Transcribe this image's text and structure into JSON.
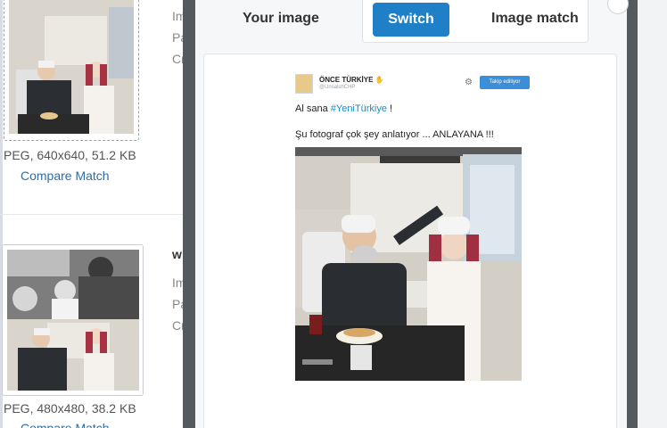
{
  "results": [
    {
      "format_size": "PEG, 640x640, 51.2 KB",
      "compare": "Compare Match",
      "labels": [
        "Im",
        "Pa",
        "Cr"
      ]
    },
    {
      "title": "w",
      "format_size": "PEG, 480x480, 38.2 KB",
      "compare": "Compare Match",
      "labels": [
        "Im",
        "Pa",
        "Cr"
      ]
    }
  ],
  "modal": {
    "tabs": {
      "your_image": "Your image",
      "switch": "Switch",
      "image_match": "Image match"
    },
    "tweet": {
      "name": "ÖNCE TÜRKİYE",
      "handle": "@UnsalshCHP",
      "follow": "Takip ediliyor",
      "line1_prefix": "Al sana ",
      "line1_hashtag": "#YeniTürkiye",
      "line1_suffix": " !",
      "line2": "Şu fotograf çok şey anlatıyor ... ANLAYANA !!!"
    }
  },
  "colors": {
    "accent": "#1f80c8",
    "link": "#2e6da4",
    "hashtag": "#1c8cc0",
    "overlay": "#555a5f"
  }
}
